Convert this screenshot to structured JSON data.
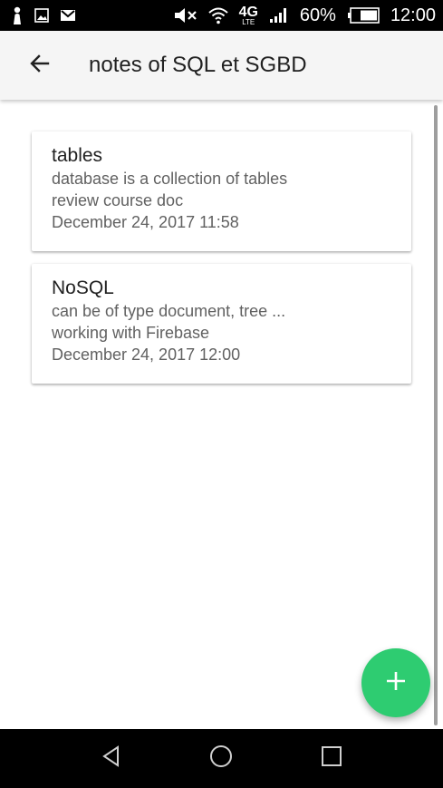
{
  "status_bar": {
    "network": "4G",
    "network_sub": "LTE",
    "battery": "60%",
    "time": "12:00",
    "icons": [
      "person-icon",
      "image-icon",
      "gmail-icon",
      "mute-icon",
      "wifi-icon",
      "signal-icon",
      "battery-icon"
    ]
  },
  "app_bar": {
    "title": "notes of SQL et SGBD",
    "back_icon": "arrow-back-icon"
  },
  "notes": [
    {
      "title": "tables",
      "line1": "database is a collection of tables",
      "line2": "review course doc",
      "date": "December 24, 2017 11:58"
    },
    {
      "title": "NoSQL",
      "line1": "can be of type document, tree ...",
      "line2": "working with Firebase",
      "date": "December 24, 2017 12:00"
    }
  ],
  "fab": {
    "icon": "plus-icon"
  },
  "nav_bar": {
    "icons": [
      "back-triangle-icon",
      "home-circle-icon",
      "recents-square-icon"
    ]
  },
  "colors": {
    "accent": "#2ecc71",
    "app_bar_bg": "#f5f5f5",
    "primary_text": "#212121",
    "secondary_text": "#616161"
  }
}
